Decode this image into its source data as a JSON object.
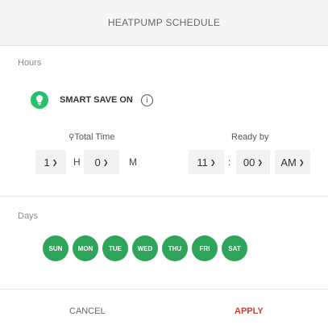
{
  "header": {
    "title": "HEATPUMP SCHEDULE"
  },
  "hours_section": {
    "label": "Hours"
  },
  "smart_save": {
    "label": "SMART SAVE ON",
    "icon": "bulb-icon",
    "info_icon": "info-icon"
  },
  "total_time": {
    "title": "Total Time",
    "hours_value": "1",
    "hours_unit": "H",
    "minutes_value": "0",
    "minutes_unit": "M"
  },
  "ready_by": {
    "title": "Ready by",
    "hour_value": "11",
    "separator": ":",
    "minute_value": "00",
    "ampm_value": "AM"
  },
  "days_section": {
    "label": "Days",
    "days": [
      "SUN",
      "MON",
      "TUE",
      "WED",
      "THU",
      "FRI",
      "SAT"
    ],
    "selected_color": "#2ea35a"
  },
  "footer": {
    "cancel_label": "CANCEL",
    "apply_label": "APPLY",
    "apply_color": "#d43a3a"
  }
}
